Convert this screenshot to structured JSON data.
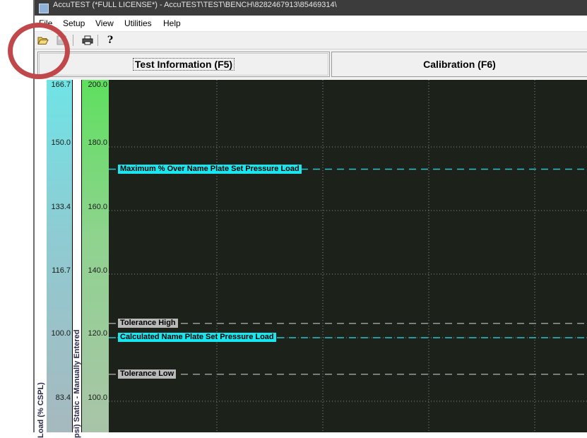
{
  "window": {
    "title": "AccuTEST (*FULL LICENSE*) - AccuTEST\\TEST\\BENCH\\8282467913\\85469314\\"
  },
  "menu": [
    "File",
    "Setup",
    "View",
    "Utilities",
    "Help"
  ],
  "toolbar": {
    "icons": [
      "open-folder-icon",
      "save-icon",
      "print-icon",
      "help-icon"
    ],
    "help_glyph": "?"
  },
  "tabs": [
    {
      "label": "Test Information (F5)",
      "active": true
    },
    {
      "label": "Calibration (F6)",
      "active": false
    }
  ],
  "colors": {
    "plot_bg": "#1c2119",
    "cyan_line": "#26c6d6",
    "grey_line": "#9a9a9a",
    "cyan_tag": "#19e6ee",
    "grey_tag": "#b9b9b9",
    "highlight": "#c0484b"
  },
  "axes": {
    "load_title": "Load (% CSPL)",
    "load_ticks": [
      "166.7",
      "150.0",
      "133.4",
      "116.7",
      "100.0",
      "83.4"
    ],
    "psi_title": "psi) Static - Manually Entered",
    "psi_ticks": [
      "200.0",
      "180.0",
      "160.0",
      "140.0",
      "120.0",
      "100.0"
    ]
  },
  "reference_lines": [
    {
      "label": "Maximum % Over Name Plate Set Pressure Load",
      "style": "cyan",
      "psi_value": 173
    },
    {
      "label": "Tolerance High",
      "style": "grey",
      "psi_value": 124.5
    },
    {
      "label": "Calculated Name Plate Set Pressure Load",
      "style": "cyan",
      "psi_value": 120
    },
    {
      "label": "Tolerance Low",
      "style": "grey",
      "psi_value": 108.5
    }
  ]
}
